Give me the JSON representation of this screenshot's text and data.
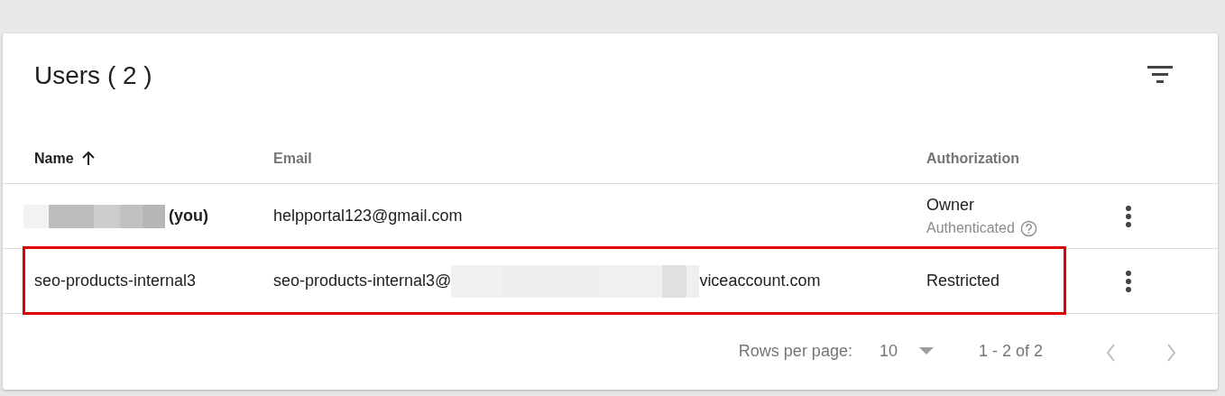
{
  "title": "Users ( 2 )",
  "table": {
    "columns": [
      {
        "label": "Name",
        "sorted": true
      },
      {
        "label": "Email",
        "sorted": false
      },
      {
        "label": "Authorization",
        "sorted": false
      }
    ],
    "rows": [
      {
        "name": "(you)",
        "name_redacted": true,
        "email_prefix": "helpportal123@gmail.com",
        "email_redacted": false,
        "role": "Owner",
        "status": "Authenticated",
        "highlighted": false
      },
      {
        "name": "seo-products-internal3",
        "name_redacted": false,
        "email_prefix": "seo-products-internal3@",
        "email_redacted": true,
        "email_suffix": "viceaccount.com",
        "role": "Restricted",
        "highlighted": true
      }
    ]
  },
  "pagination": {
    "rows_label": "Rows per page:",
    "rows_value": "10",
    "range": "1 - 2 of 2",
    "prev_disabled": true,
    "next_disabled": true
  }
}
